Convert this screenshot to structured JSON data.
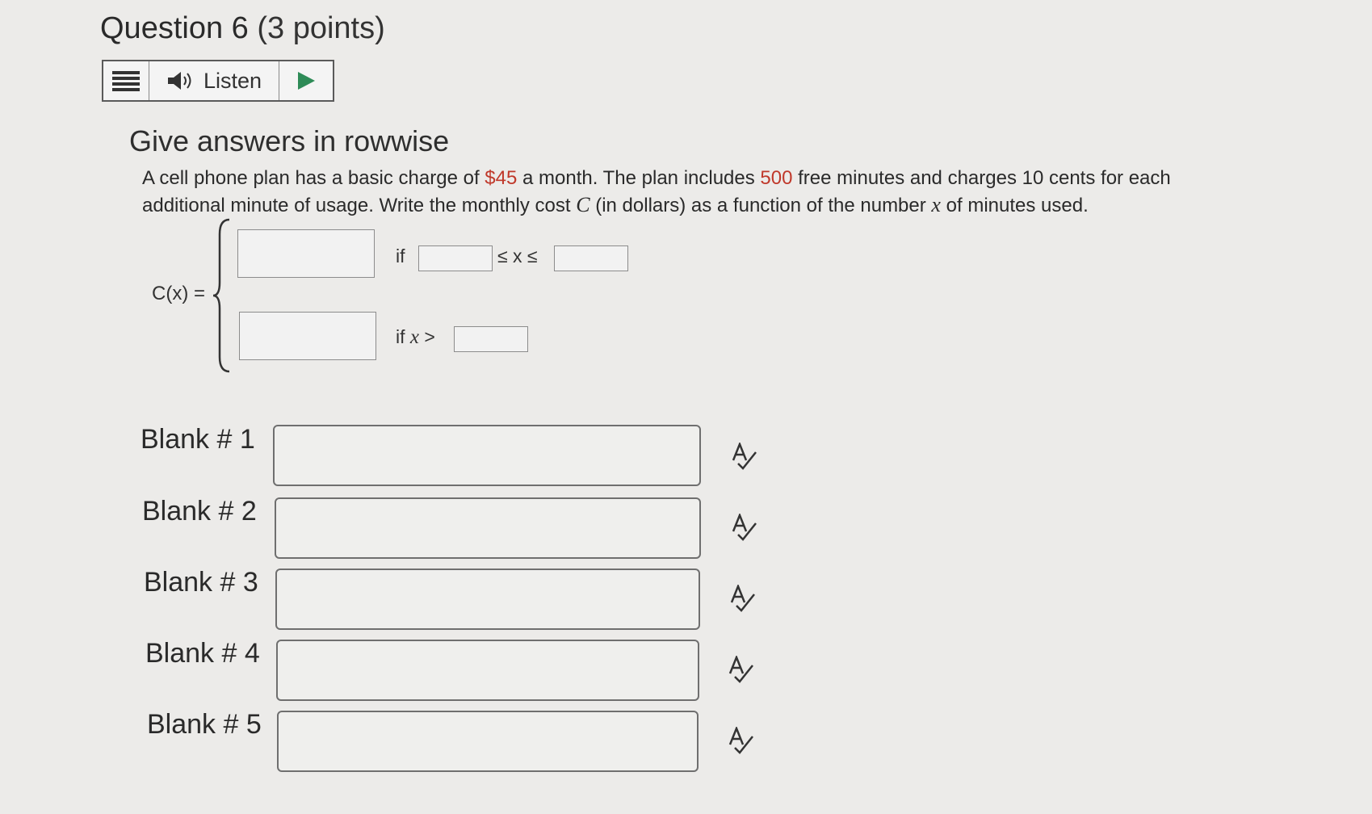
{
  "question": {
    "title": "Question 6",
    "points": "(3 points)"
  },
  "listen_bar": {
    "menu_icon": "menu-icon",
    "speaker_icon": "speaker-icon",
    "listen_label": "Listen",
    "play_icon": "play-icon"
  },
  "instruction": "Give answers in rowwise",
  "problem": {
    "part1": "A cell phone plan has a basic charge of ",
    "charge": "$45",
    "part2": " a month. The plan includes ",
    "minutes": "500",
    "part3": " free minutes and charges 10 cents for each additional minute of usage. Write the monthly cost ",
    "var_c": "C",
    "part4": " (in dollars) as a function of the number ",
    "var_x": "x",
    "part5": " of minutes used."
  },
  "piecewise": {
    "lhs": "C(x) =",
    "if1": "if",
    "ineq": "≤ x ≤",
    "if2": "if",
    "var_x": "x",
    "gt": ">"
  },
  "blanks": [
    {
      "label": "Blank # 1",
      "value": ""
    },
    {
      "label": "Blank # 2",
      "value": ""
    },
    {
      "label": "Blank # 3",
      "value": ""
    },
    {
      "label": "Blank # 4",
      "value": ""
    },
    {
      "label": "Blank # 5",
      "value": ""
    }
  ],
  "colors": {
    "highlight": "#c0392b",
    "play": "#2e8b57",
    "background": "#ecebe9"
  }
}
